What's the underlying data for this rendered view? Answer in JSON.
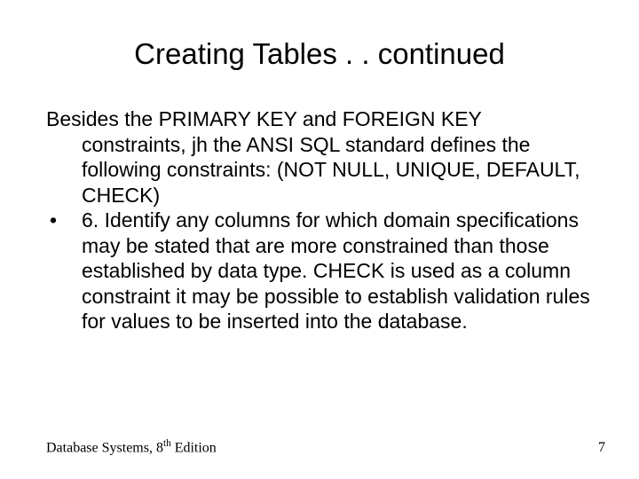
{
  "title": "Creating Tables . . continued",
  "para1_line1": "Besides the PRIMARY KEY  and FOREIGN KEY",
  "para1_rest": "constraints, jh the ANSI SQL standard defines the following constraints:   (NOT NULL, UNIQUE, DEFAULT, CHECK)",
  "bullet1": "6. Identify any columns for which domain specifications may be stated that are more constrained than those established by data type.  CHECK  is used as a column constraint it may be possible to establish validation rules for values to be inserted into the database.",
  "footer_book": "Database Systems, 8",
  "footer_sup": "th",
  "footer_edition": " Edition",
  "page_number": "7"
}
